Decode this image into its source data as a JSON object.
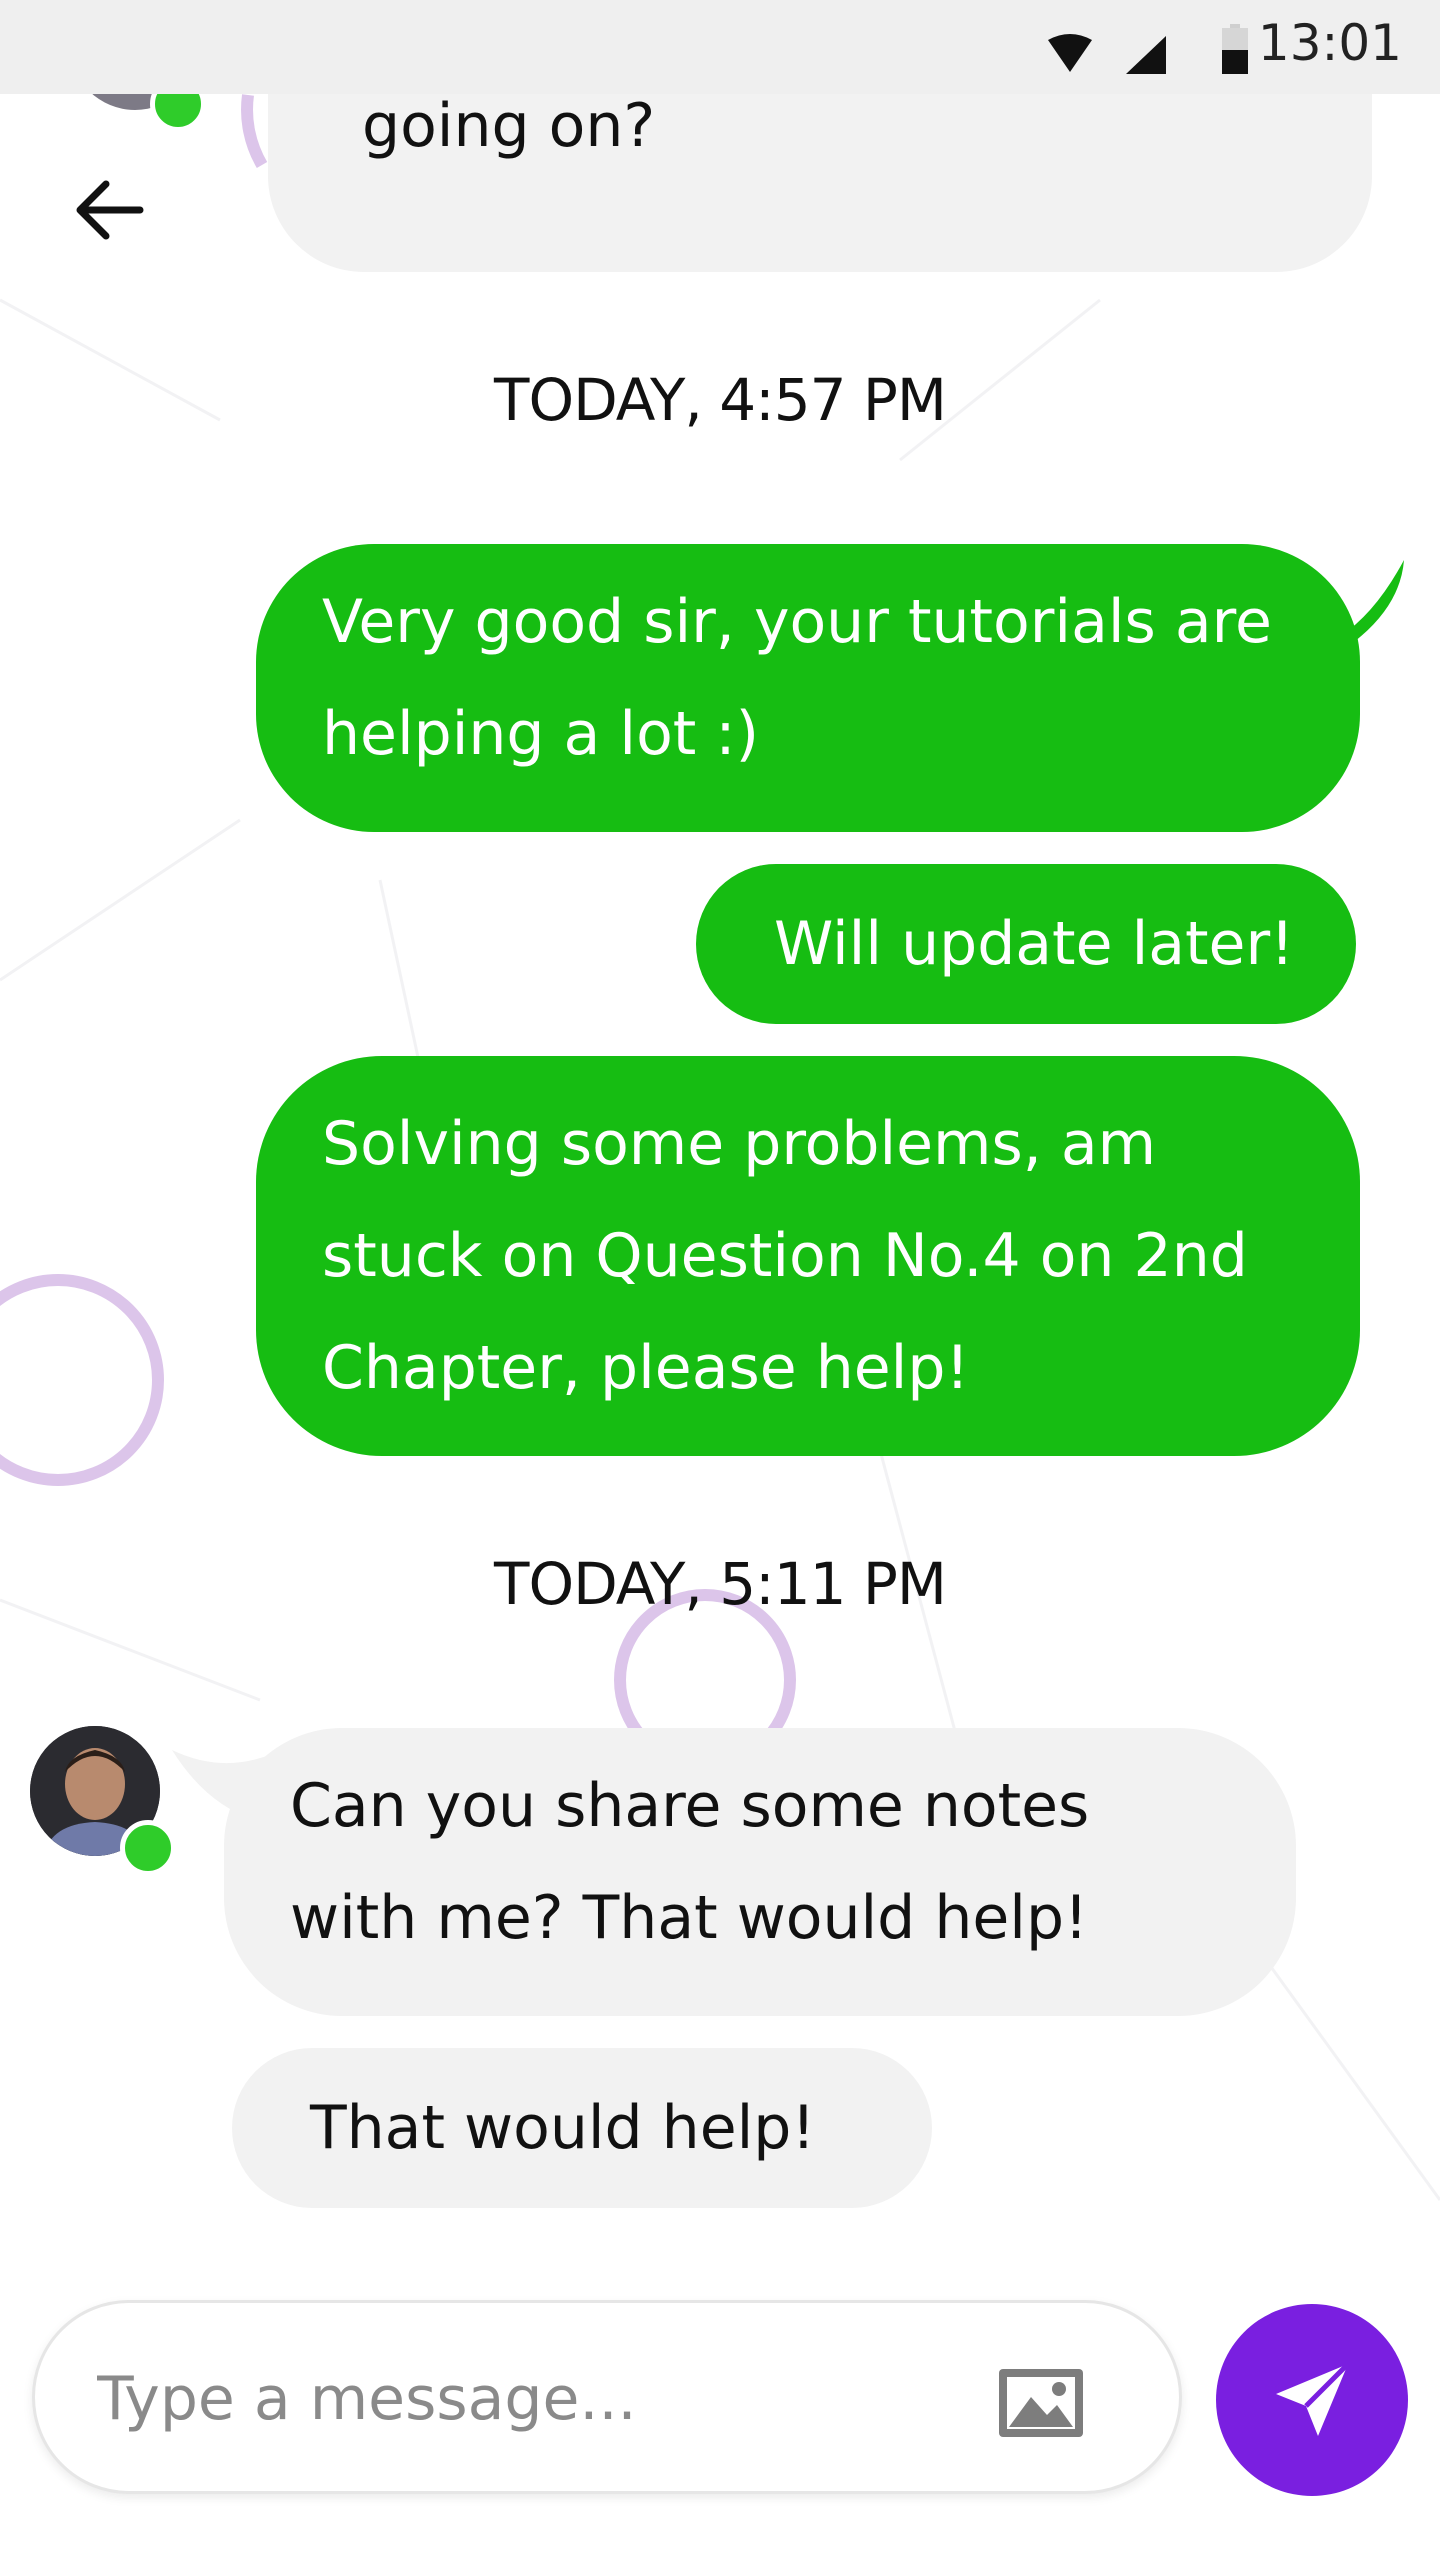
{
  "status_bar": {
    "time": "13:01",
    "icons": [
      "wifi-icon",
      "signal-icon",
      "battery-icon"
    ]
  },
  "header": {
    "back_icon": "arrow-left-icon"
  },
  "messages": {
    "prev_incoming_tail": "going on?",
    "timestamp_1": "TODAY, 4:57 PM",
    "out_1_line1": "Very good sir, your tutorials are",
    "out_1_line2": "helping a lot :)",
    "out_2": "Will update later!",
    "out_3_line1": "Solving some problems, am",
    "out_3_line2": "stuck on Question No.4 on 2nd",
    "out_3_line3": "Chapter, please help!",
    "timestamp_2": "TODAY, 5:11 PM",
    "in_1_line1": "Can you share some notes",
    "in_1_line2": "with me? That would help!",
    "in_2": "That would help!"
  },
  "composer": {
    "placeholder": "Type a message...",
    "attach_icon": "image-icon",
    "send_icon": "send-icon"
  },
  "colors": {
    "outgoing_bubble": "#16bd12",
    "incoming_bubble": "#f2f2f2",
    "send_button": "#7a1fe0",
    "online_indicator": "#2fcc2a",
    "status_bar": "#efefef",
    "decor_ring": "#dcc5ea"
  }
}
